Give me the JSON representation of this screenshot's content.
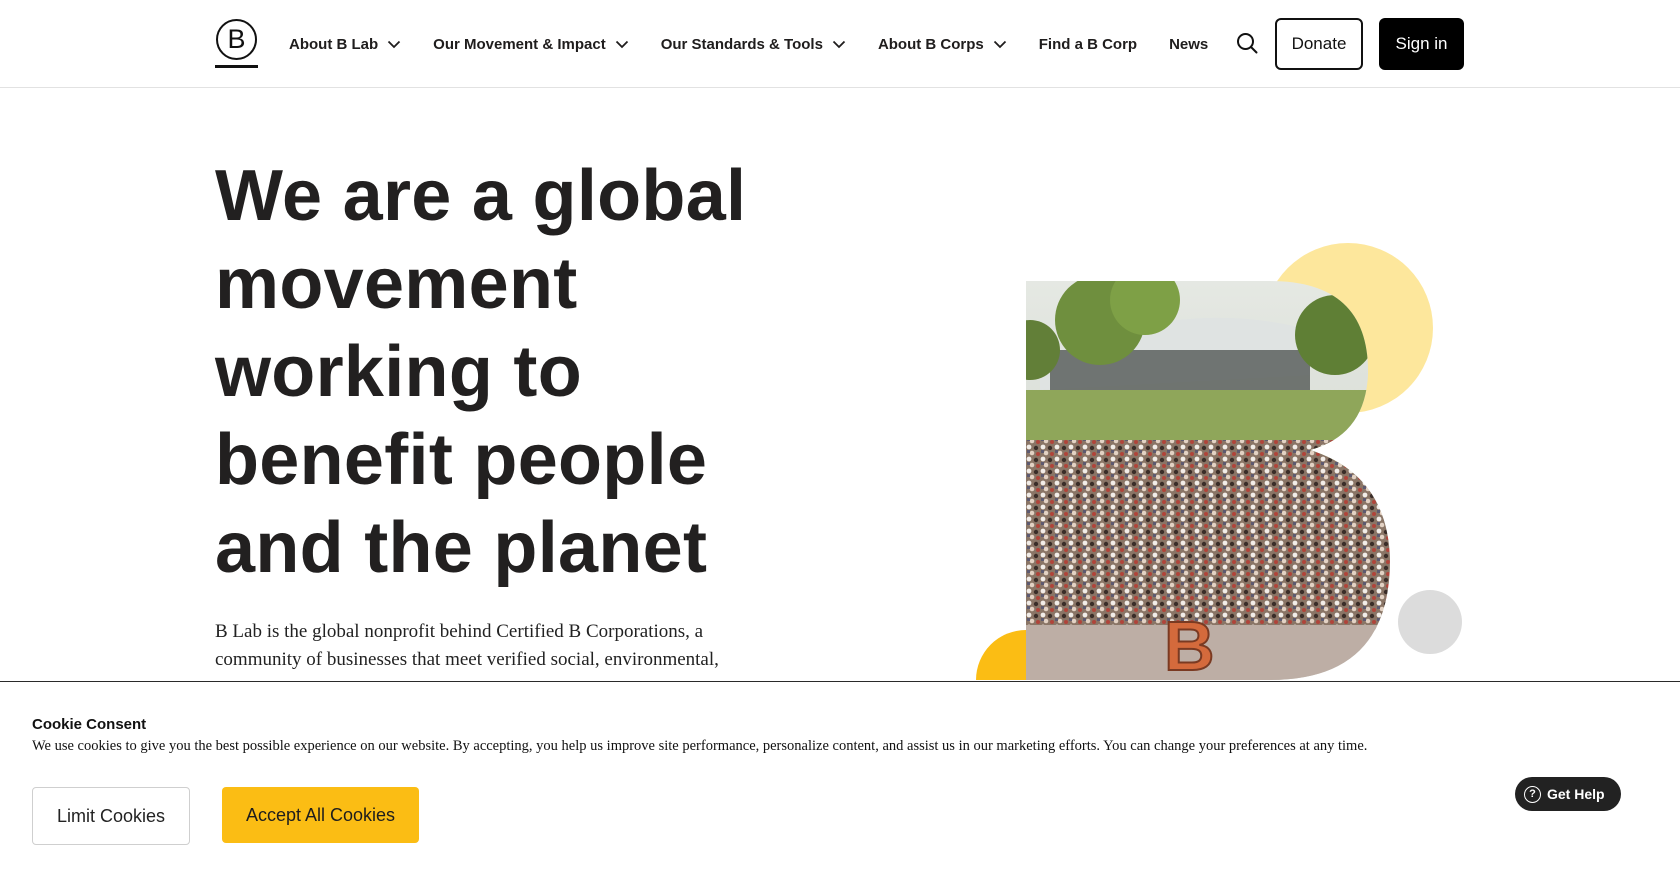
{
  "header": {
    "logo_letter": "B",
    "nav": [
      {
        "label": "About B Lab",
        "dropdown": true
      },
      {
        "label": "Our Movement & Impact",
        "dropdown": true
      },
      {
        "label": "Our Standards & Tools",
        "dropdown": true
      },
      {
        "label": "About B Corps",
        "dropdown": true
      },
      {
        "label": "Find a B Corp",
        "dropdown": false
      },
      {
        "label": "News",
        "dropdown": false
      }
    ],
    "donate_label": "Donate",
    "signin_label": "Sign in"
  },
  "hero": {
    "title_lines": [
      "We are a global",
      "movement",
      "working to",
      "benefit people",
      "and the planet"
    ],
    "description": "B Lab is the global nonprofit behind Certified B Corporations, a community of businesses that meet verified social, environmental,",
    "colors": {
      "yellow_light": "#fde79c",
      "yellow": "#fbbd14",
      "gray": "#dcdcdc"
    }
  },
  "cookie": {
    "title": "Cookie Consent",
    "text": "We use cookies to give you the best possible experience on our website. By accepting, you help us improve site performance, personalize content, and assist us in our marketing efforts. You can change your preferences at any time.",
    "limit_label": "Limit Cookies",
    "accept_label": "Accept All Cookies"
  },
  "help": {
    "label": "Get Help"
  }
}
